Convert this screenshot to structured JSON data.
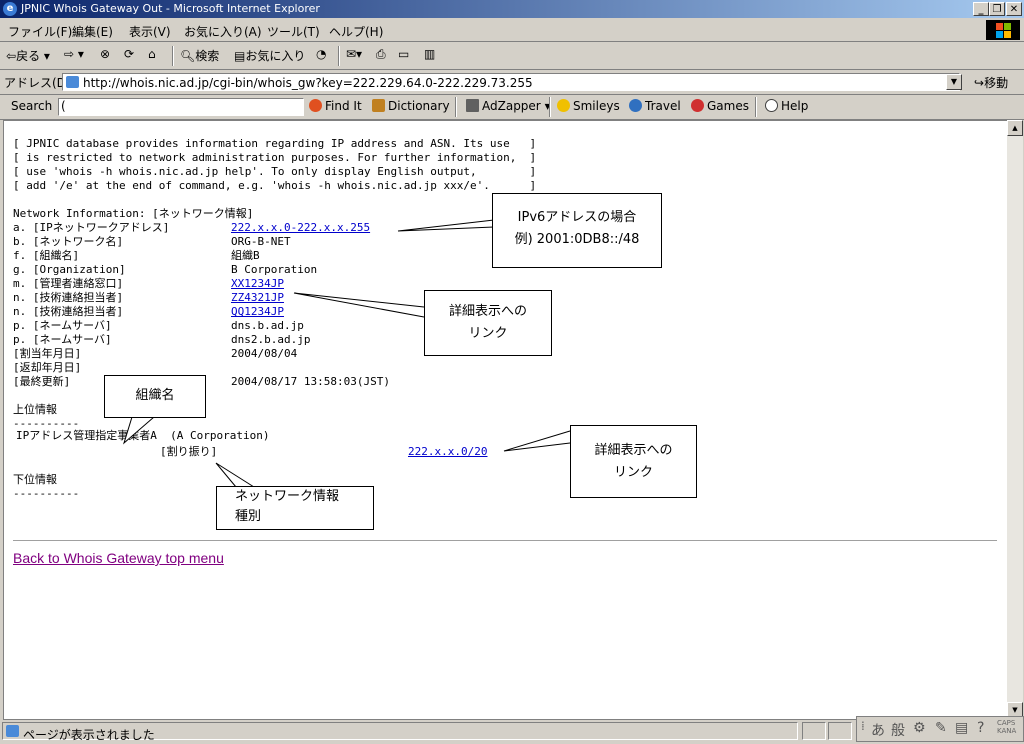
{
  "window": {
    "title": "JPNIC Whois Gateway Out - Microsoft Internet Explorer"
  },
  "menu": [
    "ファイル(F)",
    "編集(E)",
    "表示(V)",
    "お気に入り(A)",
    "ツール(T)",
    "ヘルプ(H)"
  ],
  "toolbar": {
    "back": "戻る",
    "search": "検索",
    "favorites": "お気に入り"
  },
  "address": {
    "label": "アドレス(D)",
    "url": "http://whois.nic.ad.jp/cgi-bin/whois_gw?key=222.229.64.0-222.229.73.255",
    "go": "移動"
  },
  "searchbar": {
    "label": "Search",
    "input": "(",
    "find": "Find It",
    "dictionary": "Dictionary",
    "adzapper": "AdZapper",
    "smileys": "Smileys",
    "travel": "Travel",
    "games": "Games",
    "help": "Help"
  },
  "content": {
    "notice": [
      "[ JPNIC database provides information regarding IP address and ASN. Its use   ]",
      "[ is restricted to network administration purposes. For further information,  ]",
      "[ use 'whois -h whois.nic.ad.jp help'. To only display English output,        ]",
      "[ add '/e' at the end of command, e.g. 'whois -h whois.nic.ad.jp xxx/e'.      ]"
    ],
    "section_title": "Network Information: [ネットワーク情報]",
    "rows": [
      {
        "key": "a. [IPネットワークアドレス]",
        "value": "222.x.x.0-222.x.x.255",
        "link": true
      },
      {
        "key": "b. [ネットワーク名]",
        "value": "ORG-B-NET",
        "link": false
      },
      {
        "key": "f. [組織名]",
        "value": "組織B",
        "link": false
      },
      {
        "key": "g. [Organization]",
        "value": "B Corporation",
        "link": false
      },
      {
        "key": "m. [管理者連絡窓口]",
        "value": "XX1234JP",
        "link": true
      },
      {
        "key": "n. [技術連絡担当者]",
        "value": "ZZ4321JP",
        "link": true
      },
      {
        "key": "n. [技術連絡担当者]",
        "value": "QQ1234JP",
        "link": true
      },
      {
        "key": "p. [ネームサーバ]",
        "value": "dns.b.ad.jp",
        "link": false
      },
      {
        "key": "p. [ネームサーバ]",
        "value": "dns2.b.ad.jp",
        "link": false
      },
      {
        "key": "[割当年月日]",
        "value": "2004/08/04",
        "link": false
      },
      {
        "key": "[返却年月日]",
        "value": "",
        "link": false
      },
      {
        "key": "[最終更新]",
        "value": "2004/08/17 13:58:03(JST)",
        "link": false
      }
    ],
    "upper_title": "上位情報",
    "divider": "----------",
    "upper_org": "IPアドレス管理指定事業者A  (A Corporation)",
    "upper_type": "[割り振り]",
    "upper_link": "222.x.x.0/20",
    "lower_title": "下位情報",
    "back_link": "Back to Whois Gateway top menu"
  },
  "callouts": {
    "ipv6_line1": "IPv6アドレスの場合",
    "ipv6_line2": "例) 2001:0DB8::/48",
    "detail1_line1": "詳細表示への",
    "detail1_line2": "リンク",
    "orgname": "組織名",
    "detail2_line1": "詳細表示への",
    "detail2_line2": "リンク",
    "nettype_line1": "ネットワーク情報",
    "nettype_line2": "種別"
  },
  "status": {
    "text": "ページが表示されました"
  },
  "ime": {
    "mode1": "あ",
    "mode2": "般"
  }
}
